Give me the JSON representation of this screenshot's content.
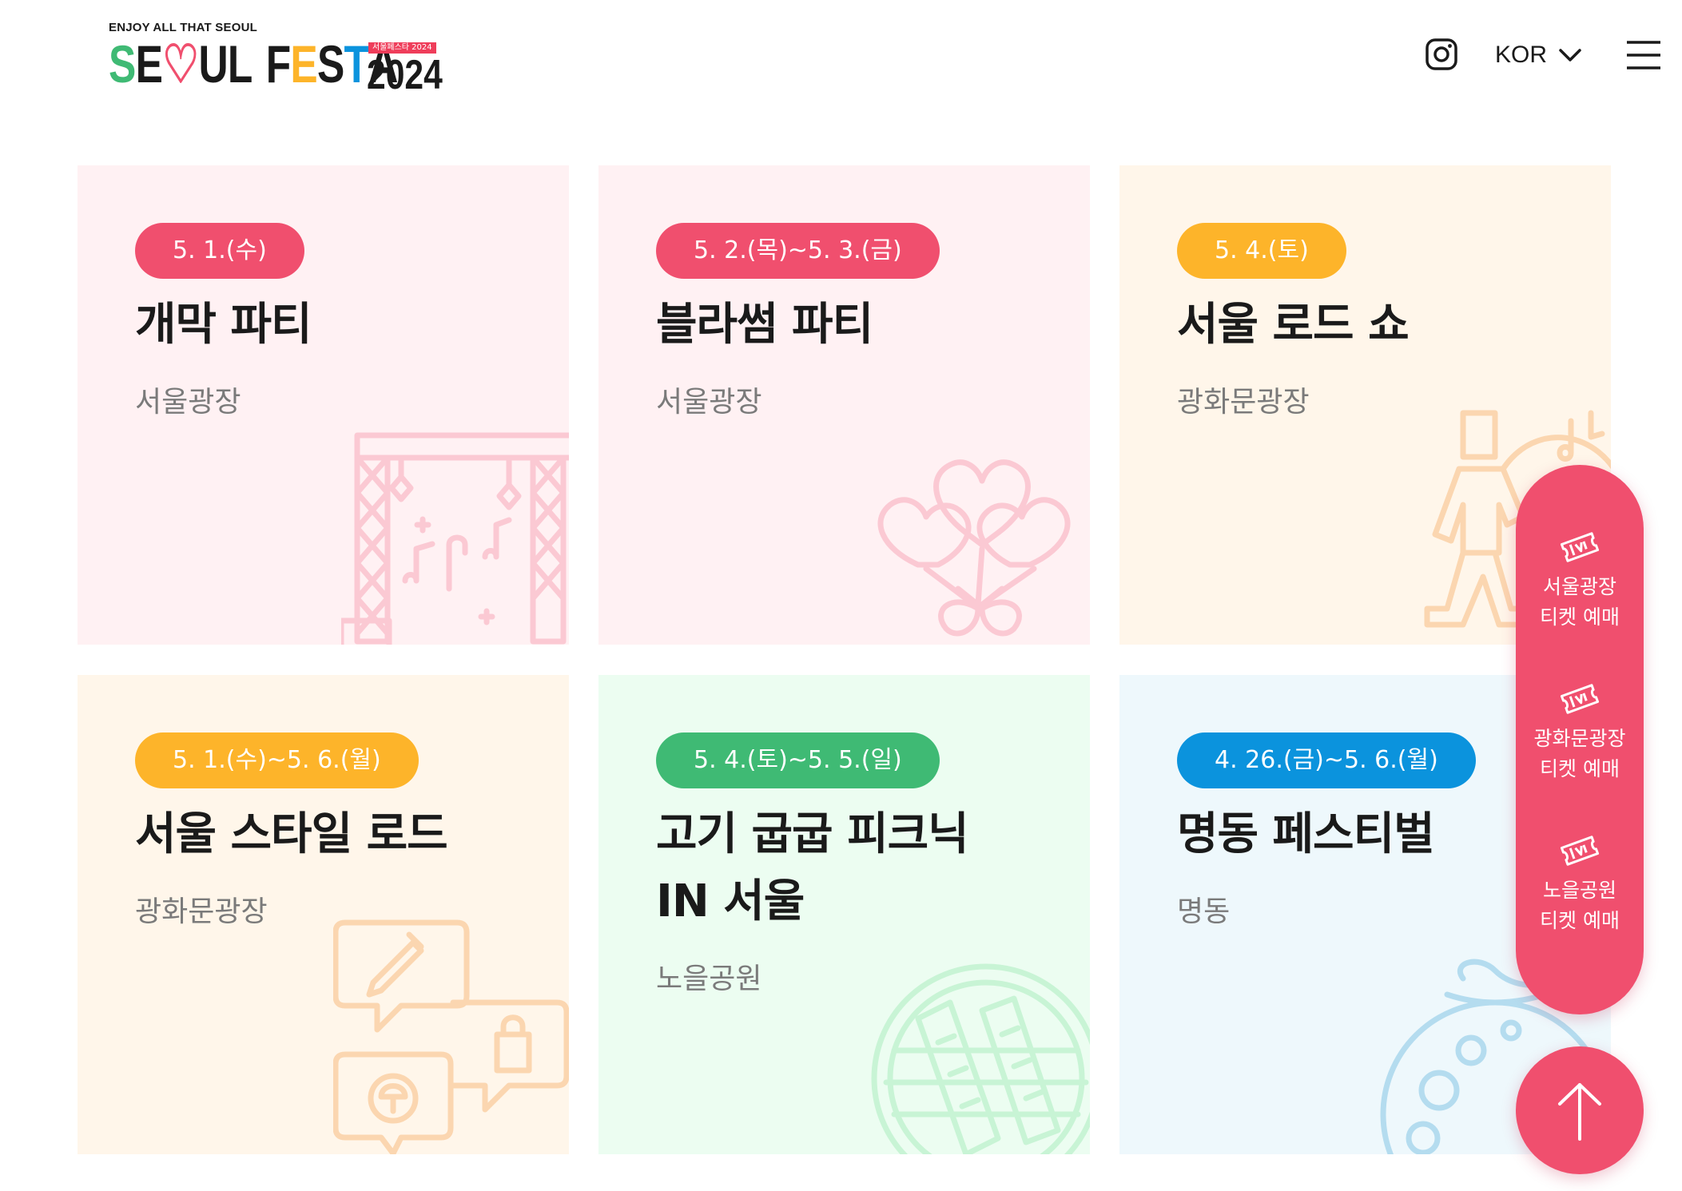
{
  "header": {
    "logo": {
      "tagline": "ENJOY ALL THAT SEOUL",
      "letters": [
        "S",
        "E",
        "♡",
        "U",
        "L",
        " ",
        "F",
        "E",
        "S",
        "T",
        "A"
      ],
      "badge": "서울페스타 2024",
      "year": "2024"
    },
    "instagram_icon": "instagram-icon",
    "language": "KOR",
    "menu_icon": "hamburger-icon"
  },
  "cards": [
    {
      "date": "5. 1.(수)",
      "title": "개막 파티",
      "venue": "서울광장",
      "bg": "#fff1f3",
      "pill": "#f04f6e",
      "illustration": "stage-icon",
      "line": "#fbc9d3"
    },
    {
      "date": "5. 2.(목)~5. 3.(금)",
      "title": "블라썸 파티",
      "venue": "서울광장",
      "bg": "#fff1f3",
      "pill": "#f04f6e",
      "illustration": "heart-balloons-icon",
      "line": "#fbc9d3"
    },
    {
      "date": "5. 4.(토)",
      "title": "서울 로드 쇼",
      "venue": "광화문광장",
      "bg": "#fff6ea",
      "pill": "#fdb42a",
      "illustration": "performer-icon",
      "line": "#fbd6b0"
    },
    {
      "date": "5. 1.(수)~5. 6.(월)",
      "title": "서울 스타일 로드",
      "venue": "광화문광장",
      "bg": "#fff6ea",
      "pill": "#fdb42a",
      "illustration": "speech-bubbles-icon",
      "line": "#fbd6b0"
    },
    {
      "date": "5. 4.(토)~5. 5.(일)",
      "title": "고기 굽굽 피크닉\nIN 서울",
      "venue": "노을공원",
      "bg": "#ecfdf1",
      "pill": "#3fba74",
      "illustration": "grill-icon",
      "line": "#c8f4d5"
    },
    {
      "date": "4. 26.(금)~5. 6.(월)",
      "title": "명동 페스티벌",
      "venue": "명동",
      "bg": "#eef8fc",
      "pill": "#0b93dd",
      "illustration": "food-plate-icon",
      "line": "#b4dcef"
    }
  ],
  "ticket_panel": {
    "items": [
      {
        "label": "서울광장\n티켓 예매",
        "icon": "ticket-icon"
      },
      {
        "label": "광화문광장\n티켓 예매",
        "icon": "ticket-icon"
      },
      {
        "label": "노을공원\n티켓 예매",
        "icon": "ticket-icon"
      }
    ],
    "color": "#f04f6e"
  },
  "scroll_top_icon": "arrow-up-icon",
  "logo_colors": {
    "green": "#3fba74",
    "pink": "#f04f6e",
    "dark": "#1a1a1a",
    "yellow": "#fdb42a",
    "blue": "#0b93dd"
  }
}
